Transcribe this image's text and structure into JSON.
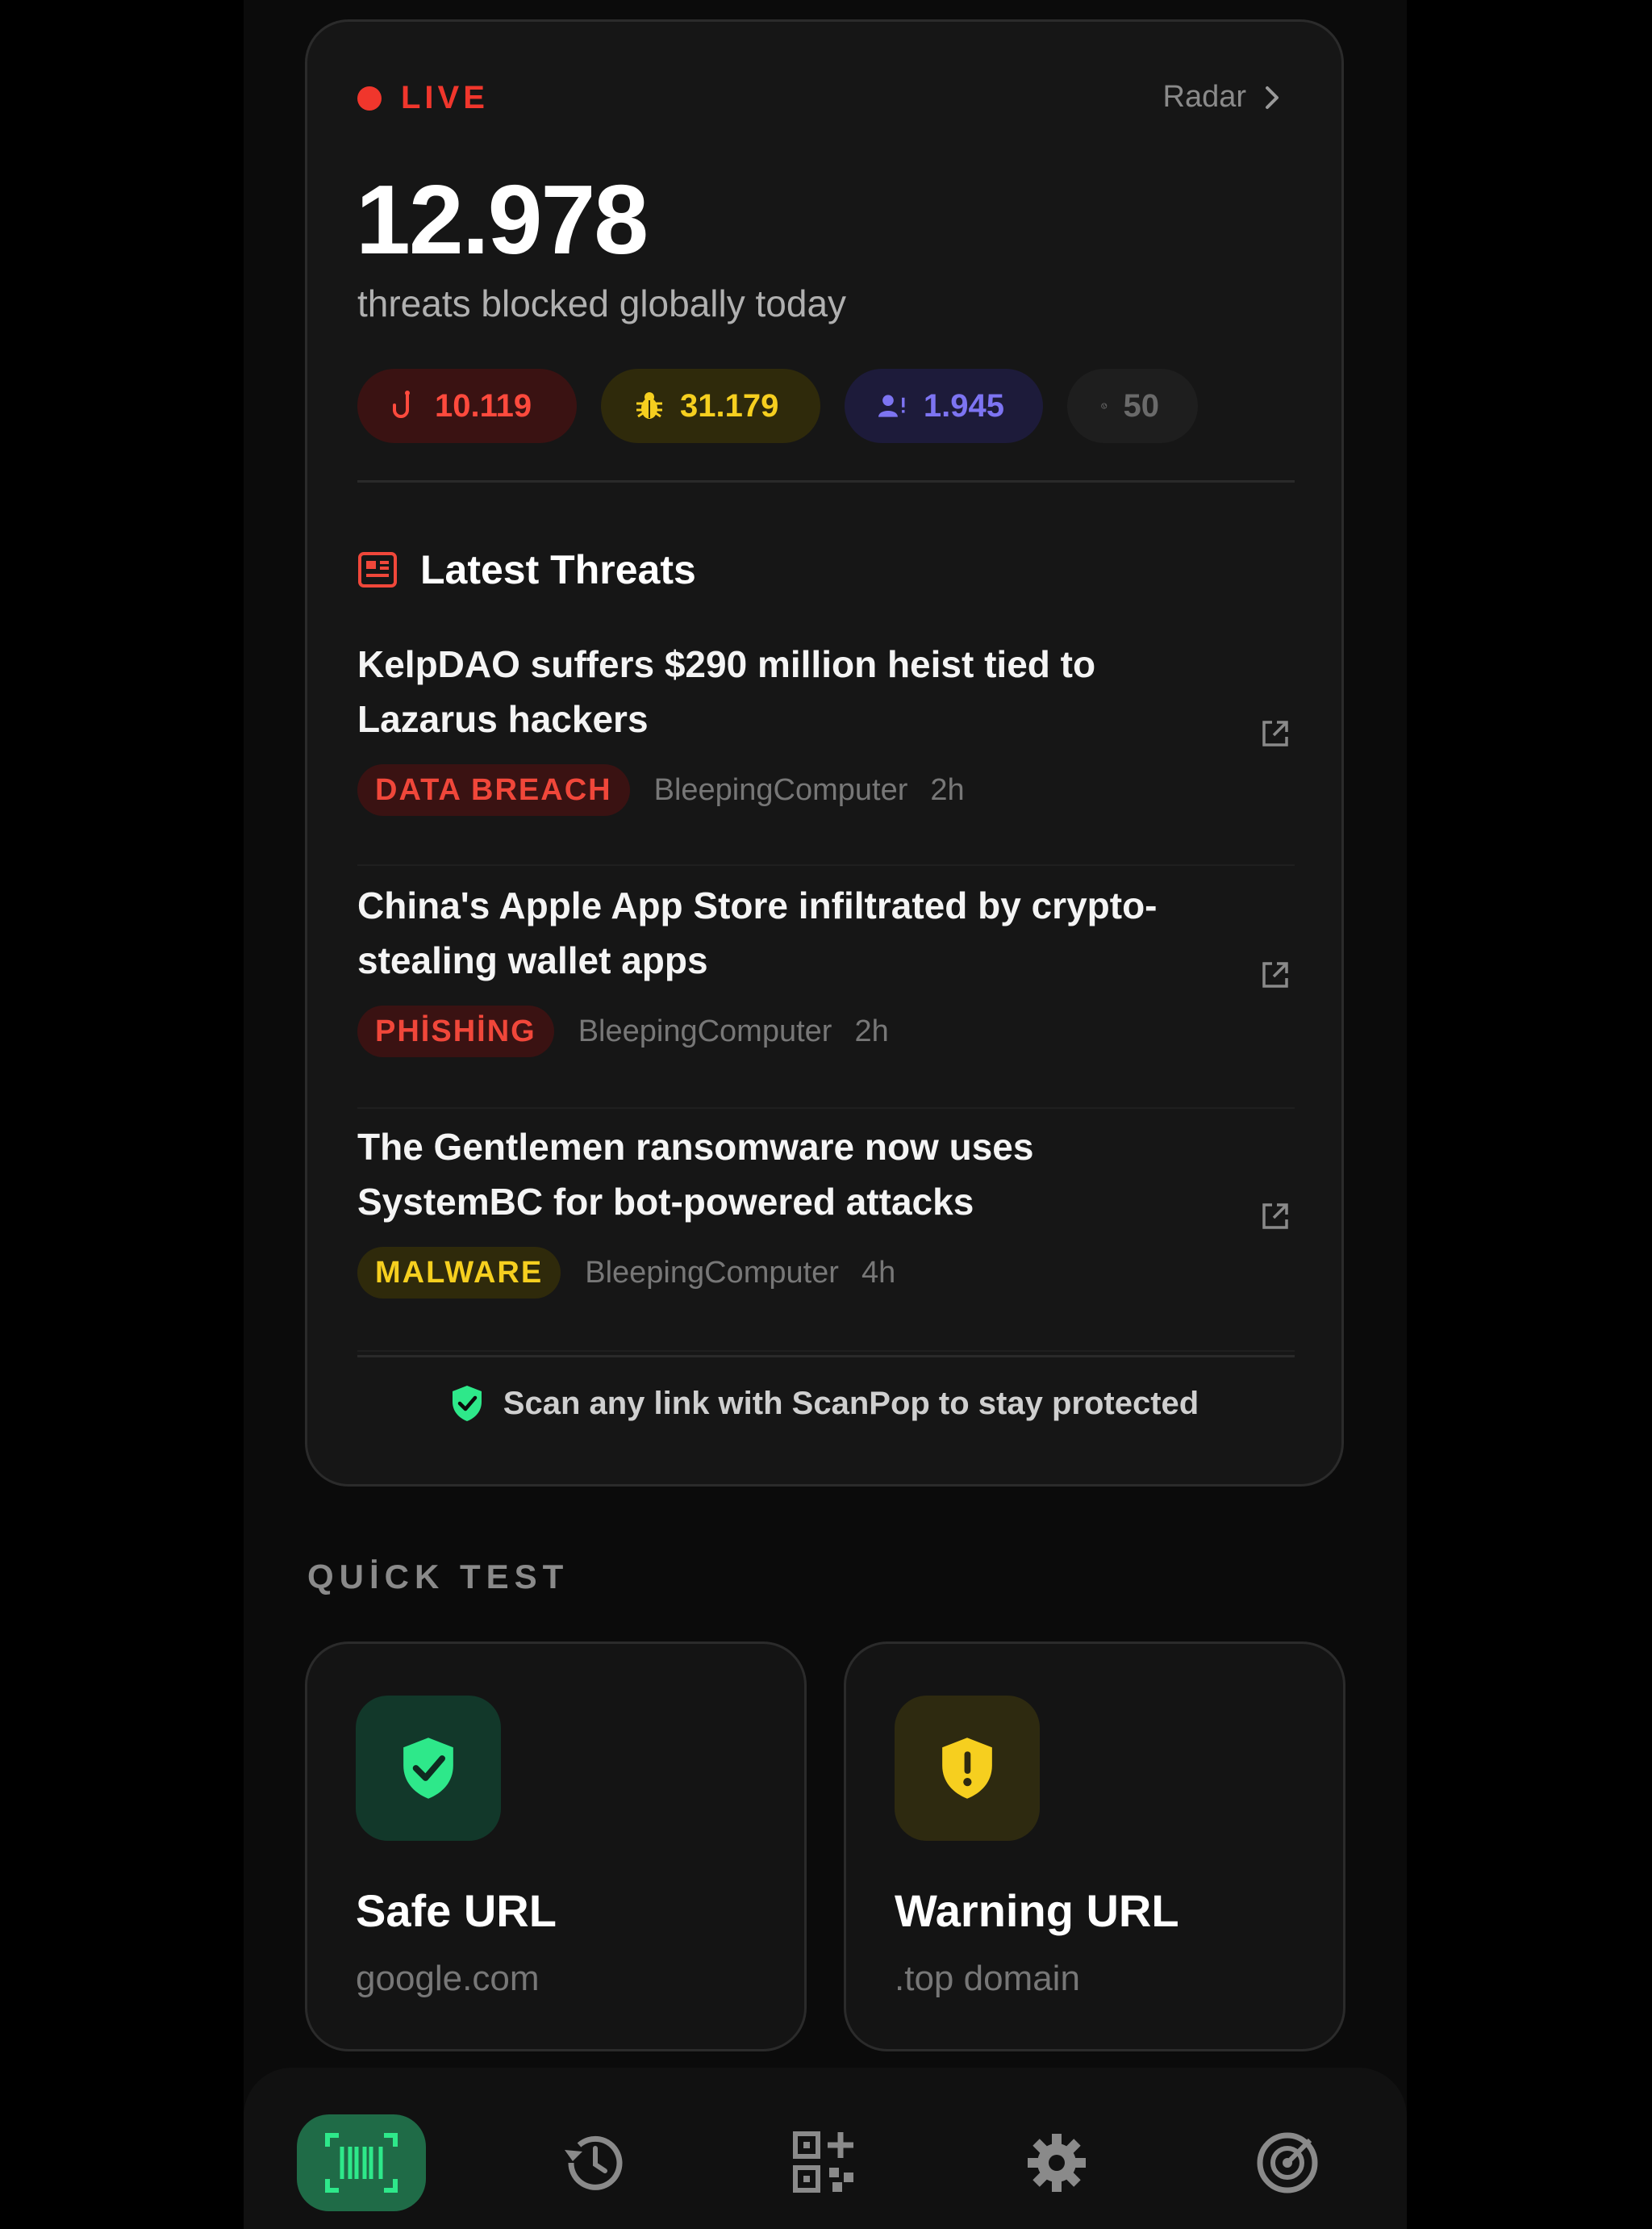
{
  "live_card": {
    "live_label": "LIVE",
    "radar_label": "Radar",
    "count": "12.978",
    "subtitle": "threats blocked globally today",
    "chips": [
      {
        "icon": "fishhook-icon",
        "value": "10.119",
        "color": "#ff4a3d"
      },
      {
        "icon": "bug-icon",
        "value": "31.179",
        "color": "#f6cf1f"
      },
      {
        "icon": "user-alert-icon",
        "value": "1.945",
        "color": "#7d74f2"
      },
      {
        "icon": "globe-icon",
        "value": "50",
        "color": "#6a6a6a"
      }
    ],
    "latest_title": "Latest Threats",
    "threats": [
      {
        "title": "KelpDAO suffers $290 million heist tied to Lazarus hackers",
        "tag": "DATA BREACH",
        "source": "BleepingComputer",
        "age": "2h"
      },
      {
        "title": "China's Apple App Store infiltrated by crypto-stealing wallet apps",
        "tag": "PHİSHİNG",
        "source": "BleepingComputer",
        "age": "2h"
      },
      {
        "title": "The Gentlemen ransomware now uses SystemBC for bot-powered attacks",
        "tag": "MALWARE",
        "source": "BleepingComputer",
        "age": "4h"
      }
    ],
    "footer_note": "Scan any link with ScanPop to stay protected"
  },
  "quick_test": {
    "heading": "QUİCK TEST",
    "cards": [
      {
        "title": "Safe URL",
        "subtitle": "google.com",
        "icon": "shield-check-icon",
        "color": "#2ee88a"
      },
      {
        "title": "Warning URL",
        "subtitle": ".top domain",
        "icon": "shield-alert-icon",
        "color": "#f6cf1f"
      }
    ]
  },
  "bottom_nav": {
    "items": [
      {
        "icon": "barcode-scan-icon",
        "active": true
      },
      {
        "icon": "history-icon",
        "active": false
      },
      {
        "icon": "qr-add-icon",
        "active": false
      },
      {
        "icon": "gear-icon",
        "active": false
      },
      {
        "icon": "radar-icon",
        "active": false
      }
    ]
  },
  "colors": {
    "accent_green": "#2ee88a",
    "live_red": "#f0362c",
    "warning_yellow": "#f6cf1f"
  }
}
